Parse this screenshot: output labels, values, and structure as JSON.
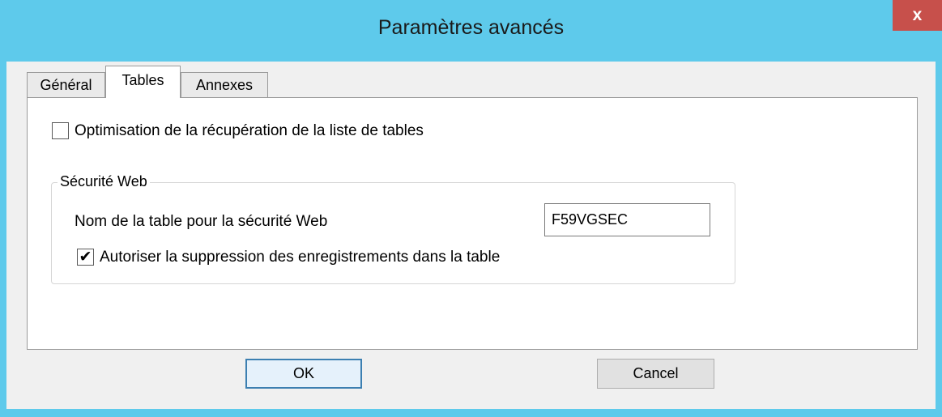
{
  "window": {
    "title": "Paramètres avancés",
    "close_symbol": "x"
  },
  "tabs": [
    {
      "label": "Général",
      "selected": false
    },
    {
      "label": "Tables",
      "selected": true
    },
    {
      "label": "Annexes",
      "selected": false
    }
  ],
  "tables_tab": {
    "optimize_checkbox": {
      "label": "Optimisation de la récupération de la liste de tables",
      "checked": false
    },
    "web_security_group": {
      "title": "Sécurité Web",
      "table_name_label": "Nom de la table pour la sécurité Web",
      "table_name_value": "F59VGSEC",
      "allow_delete_checkbox": {
        "label": "Autoriser la suppression des enregistrements dans la table",
        "checked": true,
        "check_glyph": "✔"
      }
    }
  },
  "buttons": {
    "ok_label": "OK",
    "cancel_label": "Cancel"
  },
  "colors": {
    "titlebar": "#5ecaeb",
    "close_button": "#c7504b",
    "dialog_background": "#f0f0f0"
  }
}
